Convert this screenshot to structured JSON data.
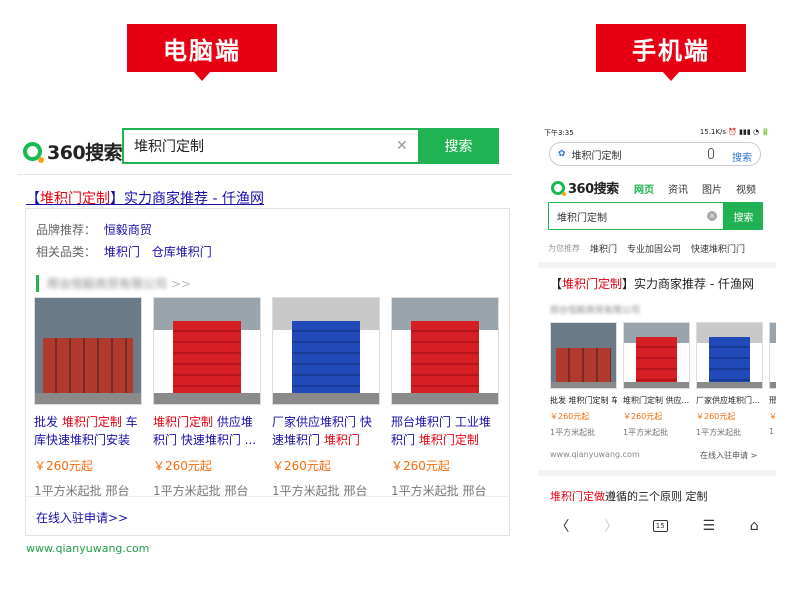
{
  "banners": {
    "pc": "电脑端",
    "mobile": "手机端"
  },
  "pc": {
    "logo_text": "360搜索",
    "query": "堆积门定制",
    "search_button": "搜索",
    "result_title_pre": "【",
    "result_title_hl": "堆积门定制",
    "result_title_post": "】实力商家推荐 - 仟渔网",
    "brand_label": "品牌推荐：",
    "brand_value": "恒毅商贸",
    "related_label": "相关品类：",
    "related_values": [
      "堆积门",
      "仓库堆积门"
    ],
    "company": "邢台恒毅商贸有限公司",
    "company_arrow": ">>",
    "items": [
      {
        "title_a": "批发 ",
        "title_hl": "堆积门定制",
        "title_b": " 车库快速堆积门安装",
        "price": "￥260元起",
        "min": "1平方米起批   邢台",
        "style": "ext"
      },
      {
        "title_a": "",
        "title_hl": "堆积门定制",
        "title_b": " 供应堆积门 快速堆积门 ...",
        "price": "￥260元起",
        "min": "1平方米起批   邢台",
        "style": "red"
      },
      {
        "title_a": "厂家供应堆积门 快速堆积门 ",
        "title_hl": "堆积门定",
        "title_b": "...",
        "price": "￥260元起",
        "min": "1平方米起批   邢台",
        "style": "blue"
      },
      {
        "title_a": "邢台堆积门 工业堆积门 ",
        "title_hl": "堆积门定制",
        "title_b": "",
        "price": "￥260元起",
        "min": "1平方米起批   邢台",
        "style": "red"
      }
    ],
    "join_link": "在线入驻申请>>",
    "domain": "www.qianyuwang.com"
  },
  "mobile": {
    "time": "下午3:35",
    "status_right": "15.1K/s ⏰ ▮▮▮ ◔ 🔋",
    "top_query": "堆积门定制",
    "top_search_button": "搜索",
    "logo_text": "360搜索",
    "tabs": [
      "网页",
      "资讯",
      "图片",
      "视频"
    ],
    "query": "堆积门定制",
    "search_button": "搜索",
    "rec_label": "为您推荐",
    "rec_chips": [
      "堆积门",
      "专业加固公司",
      "快速堆积门门"
    ],
    "title_pre": "【",
    "title_hl": "堆积门定制",
    "title_post": "】实力商家推荐 - 仟渔网",
    "company": "邢台恒毅商贸有限公司",
    "items": [
      {
        "title": "批发 堆积门定制 车...",
        "price": "￥260元起",
        "min": "1平方米起批",
        "style": "ext"
      },
      {
        "title": "堆积门定制 供应...",
        "price": "￥260元起",
        "min": "1平方米起批",
        "style": "red"
      },
      {
        "title": "厂家供应堆积门...",
        "price": "￥260元起",
        "min": "1平方米起批",
        "style": "blue"
      },
      {
        "title": "邢",
        "price": "￥",
        "min": "1",
        "style": "red"
      }
    ],
    "domain": "www.qianyuwang.com",
    "join": "在线入驻申请 >",
    "next_hl": "堆积门定做",
    "next_rest": "遵循的三个原则 定制",
    "nav": {
      "back": "〈",
      "forward": "〉",
      "tabs": "15",
      "menu": "☰",
      "home": "⌂"
    }
  }
}
